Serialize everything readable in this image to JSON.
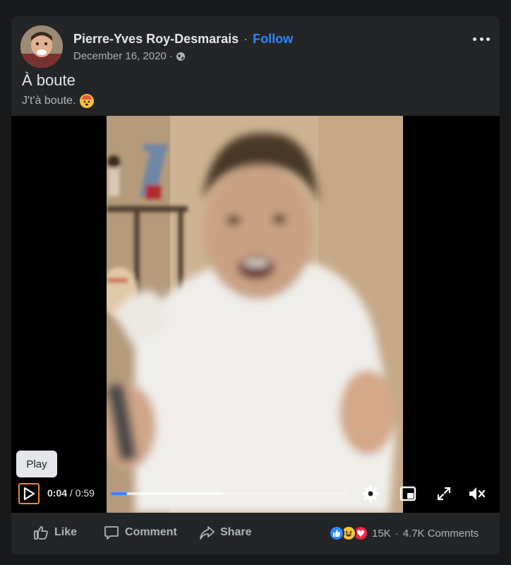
{
  "post": {
    "author": "Pierre-Yves Roy-Desmarais",
    "separator": "·",
    "follow_label": "Follow",
    "date": "December 16, 2020",
    "date_separator": "·",
    "title": "À boute",
    "caption": "J't'à boute."
  },
  "video": {
    "play_tooltip": "Play",
    "current_time": "0:04",
    "time_separator": " / ",
    "duration": "0:59",
    "progress_fraction": 0.0678,
    "buffered_fraction": 0.47
  },
  "actions": {
    "like_label": "Like",
    "comment_label": "Comment",
    "share_label": "Share"
  },
  "engagement": {
    "reaction_count": "15K",
    "separator": "·",
    "comments_count": "4.7K Comments"
  },
  "colors": {
    "accent": "#2d88ff",
    "background": "#18191a",
    "card": "#242526",
    "text_primary": "#e4e6eb",
    "text_secondary": "#b0b3b8",
    "play_outline": "#e8893a"
  }
}
